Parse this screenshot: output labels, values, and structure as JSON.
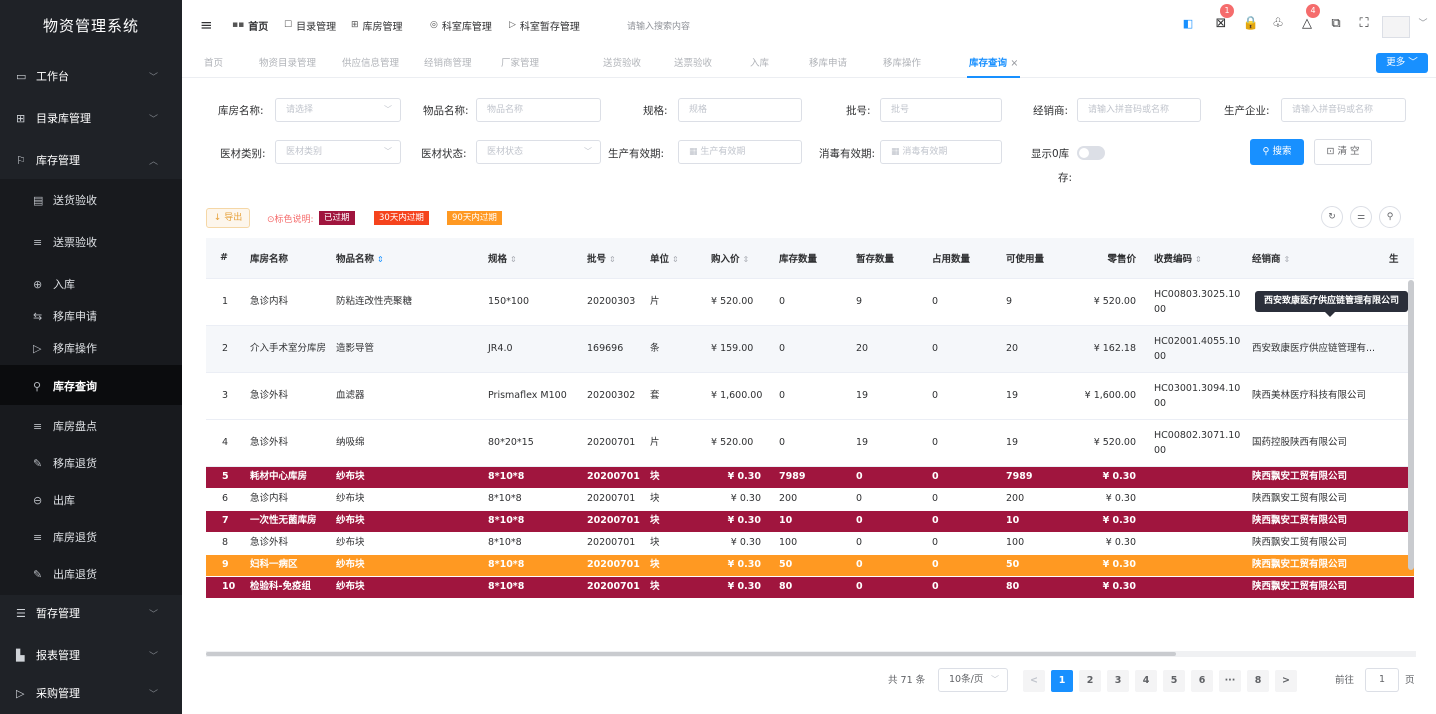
{
  "app": {
    "title": "物资管理系统"
  },
  "sidebar": {
    "sections": [
      {
        "label": "工作台",
        "icon": "monitor-icon"
      },
      {
        "label": "目录库管理",
        "icon": "grid-icon"
      },
      {
        "label": "库存管理",
        "icon": "flag-icon"
      },
      {
        "label": "暂存管理",
        "icon": "list-icon"
      },
      {
        "label": "报表管理",
        "icon": "bar-chart-icon"
      },
      {
        "label": "采购管理",
        "icon": "send-icon"
      }
    ],
    "items": [
      {
        "label": "送货验收",
        "icon": "receipt-icon"
      },
      {
        "label": "送票验收",
        "icon": "list-icon"
      },
      {
        "label": "入库",
        "icon": "plus-circle-icon"
      },
      {
        "label": "移库申请",
        "icon": "transfer-icon"
      },
      {
        "label": "移库操作",
        "icon": "send-icon"
      },
      {
        "label": "库存查询",
        "icon": "search-icon"
      },
      {
        "label": "库房盘点",
        "icon": "list-icon"
      },
      {
        "label": "移库退货",
        "icon": "edit-icon"
      },
      {
        "label": "出库",
        "icon": "minus-circle-icon"
      },
      {
        "label": "库房退货",
        "icon": "list-icon"
      },
      {
        "label": "出库退货",
        "icon": "edit-icon"
      }
    ]
  },
  "topbar": {
    "links": [
      "首页",
      "目录管理",
      "库房管理",
      "科室库管理",
      "科室暂存管理"
    ],
    "search_placeholder": "请输入搜索内容",
    "badge_1": "1",
    "badge_2": "4"
  },
  "tabs": {
    "items": [
      "首页",
      "物资目录管理",
      "供应信息管理",
      "经销商管理",
      "厂家管理",
      "送货验收",
      "送票验收",
      "入库",
      "移库申请",
      "移库操作",
      "库存查询"
    ],
    "close": "×",
    "more": "更多"
  },
  "filters": {
    "warehouse_label": "库房名称:",
    "warehouse_placeholder": "请选择",
    "item_label": "物品名称:",
    "item_placeholder": "物品名称",
    "spec_label": "规格:",
    "spec_placeholder": "规格",
    "batch_label": "批号:",
    "batch_placeholder": "批号",
    "dealer_label": "经销商:",
    "dealer_placeholder": "请输入拼音码或名称",
    "maker_label": "生产企业:",
    "maker_placeholder": "请输入拼音码或名称",
    "category_label": "医材类别:",
    "category_placeholder": "医材类别",
    "status_label": "医材状态:",
    "status_placeholder": "医材状态",
    "prod_label": "生产有效期:",
    "prod_placeholder": "生产有效期",
    "steril_label": "消毒有效期:",
    "steril_placeholder": "消毒有效期",
    "zero_label_1": "显示0库",
    "zero_label_2": "存:",
    "search_btn": "搜索",
    "clear_btn": "清 空"
  },
  "toolbar": {
    "export_label": "导出",
    "legend_label": "标色说明:",
    "legend_items": [
      "已过期",
      "30天内过期",
      "90天内过期"
    ]
  },
  "colors": {
    "expired": "#a0153e",
    "within_30": "#f5431d",
    "within_90": "#ff9922",
    "accent": "#1890ff"
  },
  "table": {
    "headers": [
      "#",
      "库房名称",
      "物品名称",
      "规格",
      "批号",
      "单位",
      "购入价",
      "库存数量",
      "暂存数量",
      "占用数量",
      "可使用量",
      "零售价",
      "收费编码",
      "经销商",
      "生"
    ],
    "rows": [
      {
        "idx": "1",
        "warehouse": "急诊内科",
        "item": "防粘连改性壳聚糖",
        "spec": "150*100",
        "batch": "20200303",
        "unit": "片",
        "price": "¥ 520.00",
        "stock": "0",
        "temp": "9",
        "occupied": "0",
        "usable": "9",
        "retail": "¥ 520.00",
        "code": "HC00803.3025.1000",
        "dealer": "",
        "extra": ""
      },
      {
        "idx": "2",
        "warehouse": "介入手术室分库房",
        "item": "造影导管",
        "spec": "JR4.0",
        "batch": "169696",
        "unit": "条",
        "price": "¥ 159.00",
        "stock": "0",
        "temp": "20",
        "occupied": "0",
        "usable": "20",
        "retail": "¥ 162.18",
        "code": "HC02001.4055.1000",
        "dealer": "西安致康医疗供应链管理有...",
        "extra": ""
      },
      {
        "idx": "3",
        "warehouse": "急诊外科",
        "item": "血滤器",
        "spec": "Prismaflex M100",
        "batch": "20200302",
        "unit": "套",
        "price": "¥ 1,600.00",
        "stock": "0",
        "temp": "19",
        "occupied": "0",
        "usable": "19",
        "retail": "¥ 1,600.00",
        "code": "HC03001.3094.1000",
        "dealer": "陕西美林医疗科技有限公司",
        "extra": ""
      },
      {
        "idx": "4",
        "warehouse": "急诊外科",
        "item": "纳吸绵",
        "spec": "80*20*15",
        "batch": "20200701",
        "unit": "片",
        "price": "¥ 520.00",
        "stock": "0",
        "temp": "19",
        "occupied": "0",
        "usable": "19",
        "retail": "¥ 520.00",
        "code": "HC00802.3071.1000",
        "dealer": "国药控股陕西有限公司",
        "extra": ""
      },
      {
        "idx": "5",
        "warehouse": "耗材中心库房",
        "item": "纱布块",
        "spec": "8*10*8",
        "batch": "20200701",
        "unit": "块",
        "price": "¥ 0.30",
        "stock": "7989",
        "temp": "0",
        "occupied": "0",
        "usable": "7989",
        "retail": "¥ 0.30",
        "code": "",
        "dealer": "陕西飘安工贸有限公司",
        "extra": ""
      },
      {
        "idx": "6",
        "warehouse": "急诊内科",
        "item": "纱布块",
        "spec": "8*10*8",
        "batch": "20200701",
        "unit": "块",
        "price": "¥ 0.30",
        "stock": "200",
        "temp": "0",
        "occupied": "0",
        "usable": "200",
        "retail": "¥ 0.30",
        "code": "",
        "dealer": "陕西飘安工贸有限公司",
        "extra": ""
      },
      {
        "idx": "7",
        "warehouse": "一次性无菌库房",
        "item": "纱布块",
        "spec": "8*10*8",
        "batch": "20200701",
        "unit": "块",
        "price": "¥ 0.30",
        "stock": "10",
        "temp": "0",
        "occupied": "0",
        "usable": "10",
        "retail": "¥ 0.30",
        "code": "",
        "dealer": "陕西飘安工贸有限公司",
        "extra": ""
      },
      {
        "idx": "8",
        "warehouse": "急诊外科",
        "item": "纱布块",
        "spec": "8*10*8",
        "batch": "20200701",
        "unit": "块",
        "price": "¥ 0.30",
        "stock": "100",
        "temp": "0",
        "occupied": "0",
        "usable": "100",
        "retail": "¥ 0.30",
        "code": "",
        "dealer": "陕西飘安工贸有限公司",
        "extra": ""
      },
      {
        "idx": "9",
        "warehouse": "妇科一病区",
        "item": "纱布块",
        "spec": "8*10*8",
        "batch": "20200701",
        "unit": "块",
        "price": "¥ 0.30",
        "stock": "50",
        "temp": "0",
        "occupied": "0",
        "usable": "50",
        "retail": "¥ 0.30",
        "code": "",
        "dealer": "陕西飘安工贸有限公司",
        "extra": ""
      },
      {
        "idx": "10",
        "warehouse": "检验科-免疫组",
        "item": "纱布块",
        "spec": "8*10*8",
        "batch": "20200701",
        "unit": "块",
        "price": "¥ 0.30",
        "stock": "80",
        "temp": "0",
        "occupied": "0",
        "usable": "80",
        "retail": "¥ 0.30",
        "code": "",
        "dealer": "陕西飘安工贸有限公司",
        "extra": ""
      }
    ],
    "tooltip": "西安致康医疗供应链管理有限公司"
  },
  "pagination": {
    "total": "共 71 条",
    "page_size": "10条/页",
    "pages": [
      "1",
      "2",
      "3",
      "4",
      "5",
      "6",
      "···",
      "8"
    ],
    "prev": "<",
    "next": ">",
    "goto_label": "前往",
    "goto_value": "1",
    "goto_suffix": "页"
  }
}
